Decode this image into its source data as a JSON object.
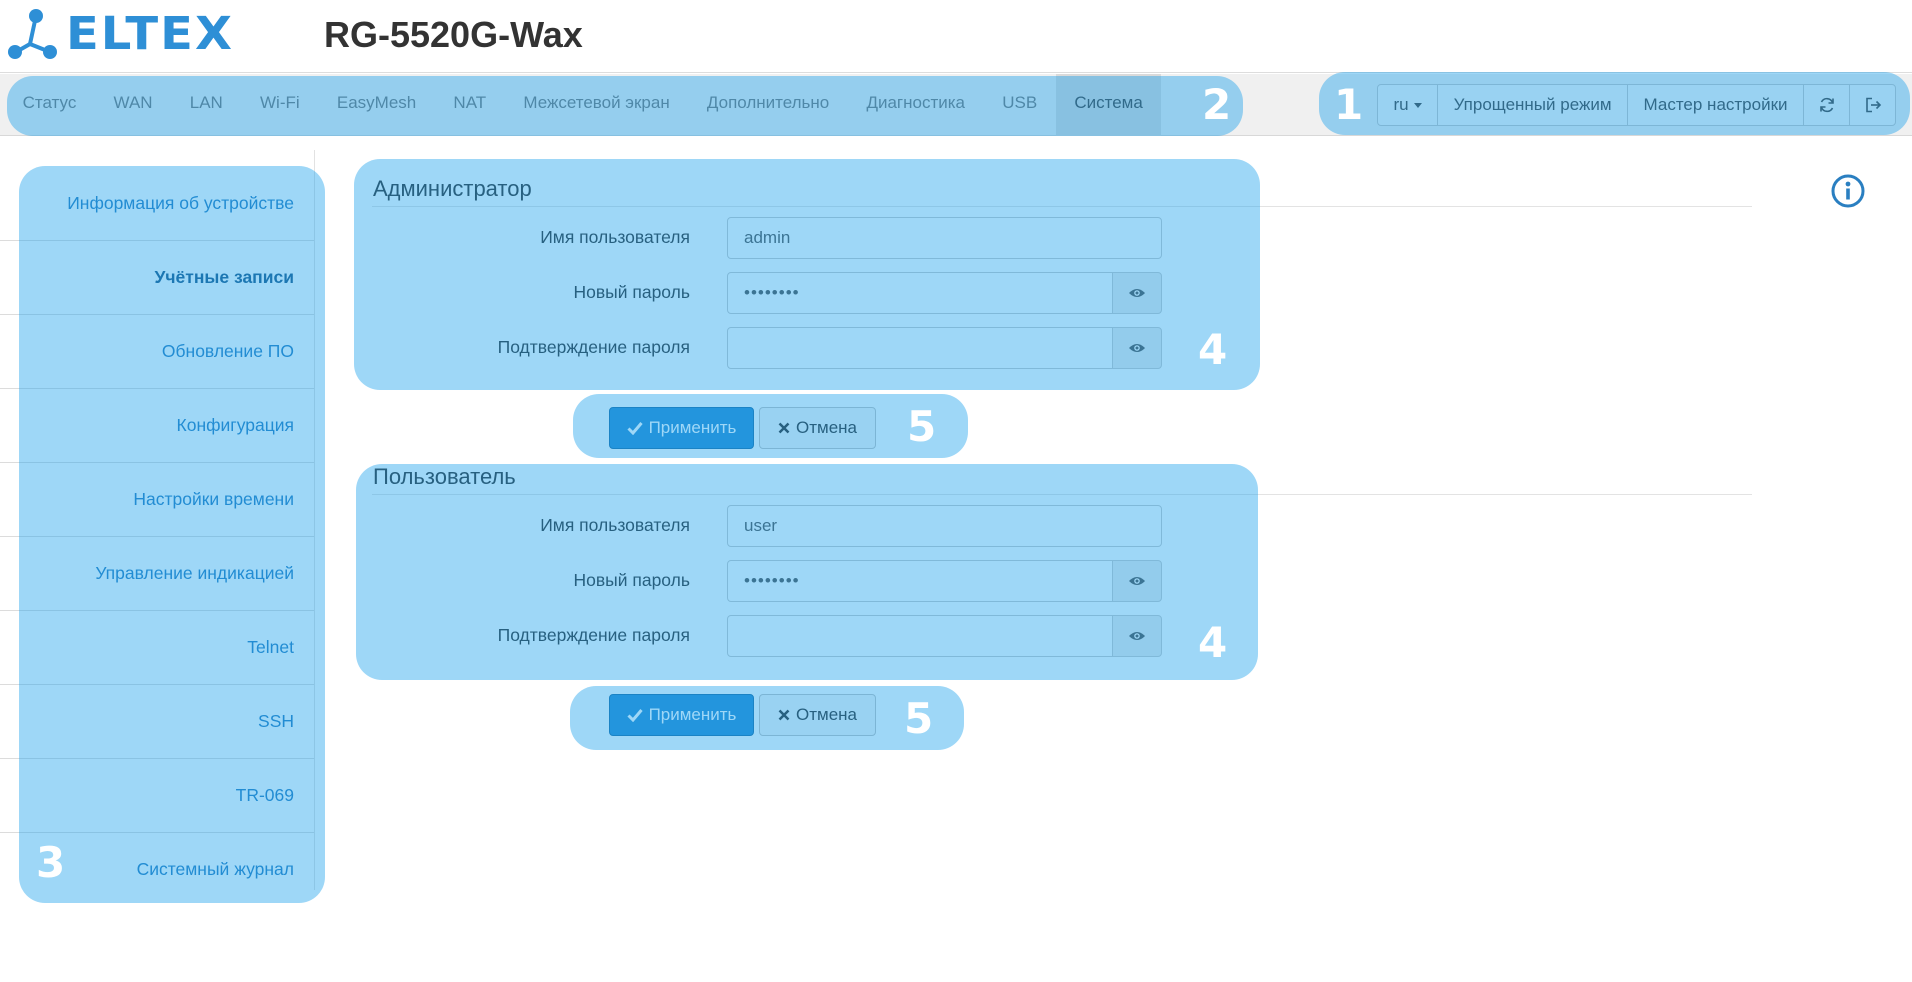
{
  "header": {
    "logo_text": "ELTEX",
    "device_title": "RG-5520G-Wax"
  },
  "nav": {
    "items": [
      {
        "label": "Статус",
        "active": false
      },
      {
        "label": "WAN",
        "active": false
      },
      {
        "label": "LAN",
        "active": false
      },
      {
        "label": "Wi-Fi",
        "active": false
      },
      {
        "label": "EasyMesh",
        "active": false
      },
      {
        "label": "NAT",
        "active": false
      },
      {
        "label": "Межсетевой экран",
        "active": false
      },
      {
        "label": "Дополнительно",
        "active": false
      },
      {
        "label": "Диагностика",
        "active": false
      },
      {
        "label": "USB",
        "active": false
      },
      {
        "label": "Система",
        "active": true
      }
    ],
    "language": "ru",
    "simple_mode": "Упрощенный режим",
    "wizard": "Мастер настройки",
    "refresh_icon": "refresh-icon",
    "logout_icon": "logout-icon"
  },
  "sidebar": {
    "items": [
      {
        "label": "Информация об устройстве",
        "active": false
      },
      {
        "label": "Учётные записи",
        "active": true
      },
      {
        "label": "Обновление ПО",
        "active": false
      },
      {
        "label": "Конфигурация",
        "active": false
      },
      {
        "label": "Настройки времени",
        "active": false
      },
      {
        "label": "Управление индикацией",
        "active": false
      },
      {
        "label": "Telnet",
        "active": false
      },
      {
        "label": "SSH",
        "active": false
      },
      {
        "label": "TR-069",
        "active": false
      },
      {
        "label": "Системный журнал",
        "active": false
      }
    ]
  },
  "admin": {
    "title": "Администратор",
    "username_label": "Имя пользователя",
    "username_value": "admin",
    "new_password_label": "Новый пароль",
    "new_password_value": "••••••••",
    "confirm_label": "Подтверждение пароля",
    "confirm_value": "",
    "apply": "Применить",
    "cancel": "Отмена"
  },
  "user": {
    "title": "Пользователь",
    "username_label": "Имя пользователя",
    "username_value": "user",
    "new_password_label": "Новый пароль",
    "new_password_value": "••••••••",
    "confirm_label": "Подтверждение пароля",
    "confirm_value": "",
    "apply": "Применить",
    "cancel": "Отмена"
  },
  "callouts": {
    "toolbar": "1",
    "menu": "2",
    "sidebar": "3",
    "admin_form": "4",
    "admin_buttons": "5",
    "user_form": "4",
    "user_buttons": "5"
  },
  "colors": {
    "accent": "#2b8ed3",
    "highlight": "#189fec",
    "link": "#2a7fc1"
  },
  "icons": {
    "info": "info-icon",
    "eye": "eye-icon",
    "check": "check-icon",
    "close": "close-icon"
  }
}
